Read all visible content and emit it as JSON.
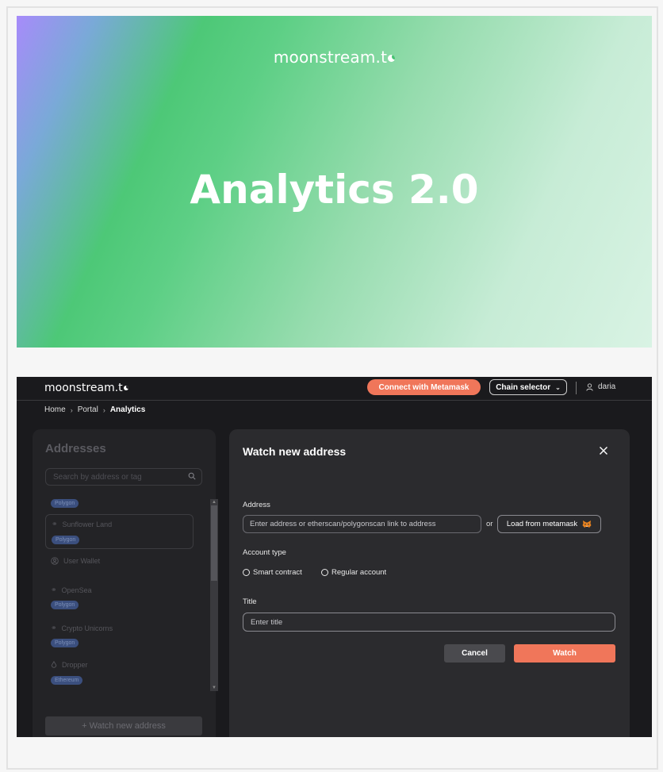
{
  "hero": {
    "logo_text": "moonstream.t",
    "title": "Analytics 2.0"
  },
  "topbar": {
    "logo_text": "moonstream.t",
    "connect_label": "Connect with Metamask",
    "chain_selector_label": "Chain selector",
    "username": "daria"
  },
  "breadcrumb": {
    "items": [
      "Home",
      "Portal",
      "Analytics"
    ]
  },
  "sidebar": {
    "title": "Addresses",
    "search_placeholder": "Search by address or tag",
    "watch_new_label": "+ Watch new address",
    "items": [
      {
        "name": "",
        "tag": "Polygon",
        "icon": "link-icon"
      },
      {
        "name": "Sunflower Land",
        "tag": "Polygon",
        "icon": "link-icon"
      },
      {
        "name": "User Wallet",
        "tag": "",
        "icon": "user-circle-icon"
      },
      {
        "name": "OpenSea",
        "tag": "Polygon",
        "icon": "link-icon"
      },
      {
        "name": "Crypto Unicorns",
        "tag": "Polygon",
        "icon": "link-icon"
      },
      {
        "name": "Dropper",
        "tag": "Ethereum",
        "icon": "drop-icon"
      }
    ]
  },
  "modal": {
    "title": "Watch new address",
    "address_label": "Address",
    "address_placeholder": "Enter address or etherscan/polygonscan link to address",
    "or_text": "or",
    "load_label": "Load from metamask",
    "account_type_label": "Account type",
    "option_smart": "Smart contract",
    "option_regular": "Regular account",
    "title_label": "Title",
    "title_placeholder": "Enter title",
    "cancel_label": "Cancel",
    "watch_label": "Watch"
  },
  "colors": {
    "accent": "#f0765a",
    "tag_bg": "#3b4f7e",
    "app_bg": "#1a1a1d"
  }
}
